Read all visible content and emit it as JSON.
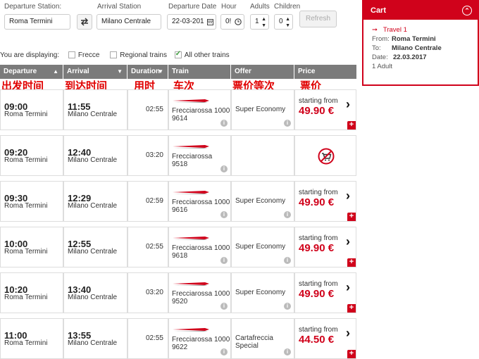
{
  "search": {
    "departure_label": "Departure Station:",
    "departure_value": "Roma Termini",
    "arrival_label": "Arrival Station",
    "arrival_value": "Milano Centrale",
    "date_label": "Departure Date",
    "date_value": "22-03-201",
    "hour_label": "Hour",
    "hour_value": "0!",
    "adults_label": "Adults",
    "adults_value": "1",
    "children_label": "Children",
    "children_value": "0",
    "refresh_label": "Refresh"
  },
  "filters": {
    "displaying_label": "You are displaying:",
    "frecce_label": "Frecce",
    "frecce_checked": false,
    "regional_label": "Regional trains",
    "regional_checked": false,
    "other_label": "All other trains",
    "other_checked": true
  },
  "table": {
    "headers": {
      "departure": "Departure",
      "arrival": "Arrival",
      "duration": "Duration",
      "train": "Train",
      "offer": "Offer",
      "price": "Price"
    },
    "annotations": {
      "departure": "出发时间",
      "arrival": "到达时间",
      "duration": "用时",
      "train": "车次",
      "offer": "票价等次",
      "price": "票价"
    },
    "logo_text": "FRECCIAROSSA",
    "rows": [
      {
        "dep_time": "09:00",
        "dep_station": "Roma Termini",
        "arr_time": "11:55",
        "arr_station": "Milano Centrale",
        "duration": "02:55",
        "train_line1": "Frecciarossa 1000",
        "train_line2": "9614",
        "offer": "Super Economy",
        "price_from": "starting from",
        "price": "49.90 €",
        "available": true
      },
      {
        "dep_time": "09:20",
        "dep_station": "Roma Termini",
        "arr_time": "12:40",
        "arr_station": "Milano Centrale",
        "duration": "03:20",
        "train_line1": "Frecciarossa",
        "train_line2": "9518",
        "offer": "",
        "price_from": "",
        "price": "",
        "available": false
      },
      {
        "dep_time": "09:30",
        "dep_station": "Roma Termini",
        "arr_time": "12:29",
        "arr_station": "Milano Centrale",
        "duration": "02:59",
        "train_line1": "Frecciarossa 1000",
        "train_line2": "9616",
        "offer": "Super Economy",
        "price_from": "starting from",
        "price": "49.90 €",
        "available": true
      },
      {
        "dep_time": "10:00",
        "dep_station": "Roma Termini",
        "arr_time": "12:55",
        "arr_station": "Milano Centrale",
        "duration": "02:55",
        "train_line1": "Frecciarossa 1000",
        "train_line2": "9618",
        "offer": "Super Economy",
        "price_from": "starting from",
        "price": "49.90 €",
        "available": true
      },
      {
        "dep_time": "10:20",
        "dep_station": "Roma Termini",
        "arr_time": "13:40",
        "arr_station": "Milano Centrale",
        "duration": "03:20",
        "train_line1": "Frecciarossa 1000",
        "train_line2": "9520",
        "offer": "Super Economy",
        "price_from": "starting from",
        "price": "49.90 €",
        "available": true
      },
      {
        "dep_time": "11:00",
        "dep_station": "Roma Termini",
        "arr_time": "13:55",
        "arr_station": "Milano Centrale",
        "duration": "02:55",
        "train_line1": "Frecciarossa 1000",
        "train_line2": "9622",
        "offer": "Cartafreccia Special",
        "offer_line1": "Cartafreccia",
        "offer_line2": "Special",
        "price_from": "starting from",
        "price": "44.50 €",
        "available": true
      }
    ]
  },
  "cart": {
    "title": "Cart",
    "travel_label": "Travel 1",
    "from_label": "From:",
    "from_value": "Roma Termini",
    "to_label": "To:",
    "to_value": "Milano Centrale",
    "date_label": "Date:",
    "date_value": "22.03.2017",
    "passengers": "1 Adult"
  },
  "colors": {
    "accent": "#d0021b",
    "header_bg": "#7b7b7b"
  }
}
